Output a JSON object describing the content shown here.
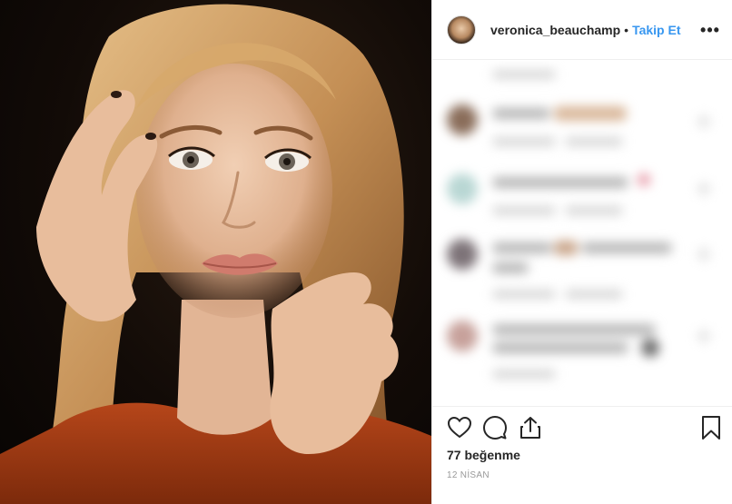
{
  "post": {
    "photo_alt": "",
    "header": {
      "username": "veronica_beauchamp",
      "separator": "•",
      "follow_label": "Takip Et",
      "more_label": "•••"
    },
    "footer": {
      "likes_text": "77 beğenme",
      "date_text": "12 NİSAN"
    },
    "icons": {
      "like": "heart-outline-icon",
      "comment": "speech-bubble-icon",
      "share": "share-arrow-icon",
      "save": "bookmark-icon",
      "more": "more-dots-icon"
    },
    "colors": {
      "accent": "#3897f0",
      "text": "#262626",
      "muted": "#999999",
      "divider": "#efefef"
    }
  }
}
